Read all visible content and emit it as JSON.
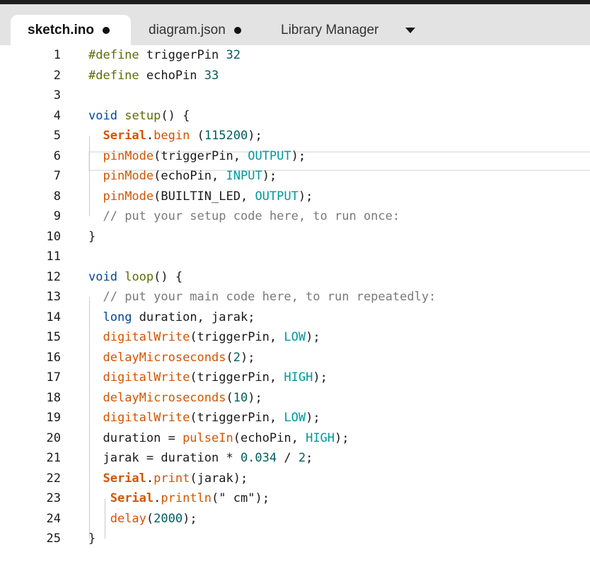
{
  "tabs": [
    {
      "label": "sketch.ino",
      "modified": true,
      "active": true
    },
    {
      "label": "diagram.json",
      "modified": true,
      "active": false
    },
    {
      "label": "Library Manager",
      "modified": false,
      "active": false
    }
  ],
  "tab_menu_icon": "caret-down-icon",
  "colors": {
    "keyword": "#00479c",
    "function": "#5e6d03",
    "number": "#005c5f",
    "constant": "#00979c",
    "arduino_builtin": "#d35400",
    "comment": "#7a7a7a"
  },
  "editor": {
    "current_line": 4,
    "lines": [
      {
        "n": "1",
        "tokens": [
          {
            "t": "#define",
            "c": "def"
          },
          {
            "t": " triggerPin "
          },
          {
            "t": "32",
            "c": "num"
          }
        ]
      },
      {
        "n": "2",
        "tokens": [
          {
            "t": "#define",
            "c": "def"
          },
          {
            "t": " echoPin "
          },
          {
            "t": "33",
            "c": "num"
          }
        ]
      },
      {
        "n": "3",
        "tokens": []
      },
      {
        "n": "4",
        "tokens": [
          {
            "t": "void",
            "c": "kw"
          },
          {
            "t": " "
          },
          {
            "t": "setup",
            "c": "fn"
          },
          {
            "t": "() {"
          }
        ]
      },
      {
        "n": "5",
        "tokens": [
          {
            "t": "  "
          },
          {
            "t": "Serial",
            "c": "obj"
          },
          {
            "t": ".",
            "c": ""
          },
          {
            "t": "begin",
            "c": "ard"
          },
          {
            "t": " ("
          },
          {
            "t": "115200",
            "c": "num"
          },
          {
            "t": ");"
          }
        ]
      },
      {
        "n": "6",
        "tokens": [
          {
            "t": "  "
          },
          {
            "t": "pinMode",
            "c": "ard"
          },
          {
            "t": "(triggerPin, "
          },
          {
            "t": "OUTPUT",
            "c": "const"
          },
          {
            "t": ");"
          }
        ]
      },
      {
        "n": "7",
        "tokens": [
          {
            "t": "  "
          },
          {
            "t": "pinMode",
            "c": "ard"
          },
          {
            "t": "(echoPin, "
          },
          {
            "t": "INPUT",
            "c": "const"
          },
          {
            "t": ");"
          }
        ]
      },
      {
        "n": "8",
        "tokens": [
          {
            "t": "  "
          },
          {
            "t": "pinMode",
            "c": "ard"
          },
          {
            "t": "(BUILTIN_LED, "
          },
          {
            "t": "OUTPUT",
            "c": "const"
          },
          {
            "t": ");"
          }
        ]
      },
      {
        "n": "9",
        "tokens": [
          {
            "t": "  "
          },
          {
            "t": "// put your setup code here, to run once:",
            "c": "cm"
          }
        ]
      },
      {
        "n": "10",
        "tokens": [
          {
            "t": "}"
          }
        ]
      },
      {
        "n": "11",
        "tokens": []
      },
      {
        "n": "12",
        "tokens": [
          {
            "t": "void",
            "c": "kw"
          },
          {
            "t": " "
          },
          {
            "t": "loop",
            "c": "fn"
          },
          {
            "t": "() {"
          }
        ]
      },
      {
        "n": "13",
        "tokens": [
          {
            "t": "  "
          },
          {
            "t": "// put your main code here, to run repeatedly:",
            "c": "cm"
          }
        ]
      },
      {
        "n": "14",
        "tokens": [
          {
            "t": "  "
          },
          {
            "t": "long",
            "c": "kw"
          },
          {
            "t": " duration, jarak;"
          }
        ]
      },
      {
        "n": "15",
        "tokens": [
          {
            "t": "  "
          },
          {
            "t": "digitalWrite",
            "c": "ard"
          },
          {
            "t": "(triggerPin, "
          },
          {
            "t": "LOW",
            "c": "const"
          },
          {
            "t": ");"
          }
        ]
      },
      {
        "n": "16",
        "tokens": [
          {
            "t": "  "
          },
          {
            "t": "delayMicroseconds",
            "c": "ard"
          },
          {
            "t": "("
          },
          {
            "t": "2",
            "c": "num"
          },
          {
            "t": ");"
          }
        ]
      },
      {
        "n": "17",
        "tokens": [
          {
            "t": "  "
          },
          {
            "t": "digitalWrite",
            "c": "ard"
          },
          {
            "t": "(triggerPin, "
          },
          {
            "t": "HIGH",
            "c": "const"
          },
          {
            "t": ");"
          }
        ]
      },
      {
        "n": "18",
        "tokens": [
          {
            "t": "  "
          },
          {
            "t": "delayMicroseconds",
            "c": "ard"
          },
          {
            "t": "("
          },
          {
            "t": "10",
            "c": "num"
          },
          {
            "t": ");"
          }
        ]
      },
      {
        "n": "19",
        "tokens": [
          {
            "t": "  "
          },
          {
            "t": "digitalWrite",
            "c": "ard"
          },
          {
            "t": "(triggerPin, "
          },
          {
            "t": "LOW",
            "c": "const"
          },
          {
            "t": ");"
          }
        ]
      },
      {
        "n": "20",
        "tokens": [
          {
            "t": "  duration = "
          },
          {
            "t": "pulseIn",
            "c": "ard"
          },
          {
            "t": "(echoPin, "
          },
          {
            "t": "HIGH",
            "c": "const"
          },
          {
            "t": ");"
          }
        ]
      },
      {
        "n": "21",
        "tokens": [
          {
            "t": "  jarak = duration * "
          },
          {
            "t": "0.034",
            "c": "num"
          },
          {
            "t": " / "
          },
          {
            "t": "2",
            "c": "num"
          },
          {
            "t": ";"
          }
        ]
      },
      {
        "n": "22",
        "tokens": [
          {
            "t": "  "
          },
          {
            "t": "Serial",
            "c": "obj"
          },
          {
            "t": "."
          },
          {
            "t": "print",
            "c": "ard"
          },
          {
            "t": "(jarak);"
          }
        ]
      },
      {
        "n": "23",
        "tokens": [
          {
            "t": "   "
          },
          {
            "t": "Serial",
            "c": "obj"
          },
          {
            "t": "."
          },
          {
            "t": "println",
            "c": "ard"
          },
          {
            "t": "(\""
          },
          {
            "t": " cm",
            "c": ""
          },
          {
            "t": "\");"
          }
        ]
      },
      {
        "n": "24",
        "tokens": [
          {
            "t": "   "
          },
          {
            "t": "delay",
            "c": "ard"
          },
          {
            "t": "("
          },
          {
            "t": "2000",
            "c": "num"
          },
          {
            "t": ");"
          }
        ]
      },
      {
        "n": "25",
        "tokens": [
          {
            "t": "}"
          }
        ]
      }
    ]
  }
}
